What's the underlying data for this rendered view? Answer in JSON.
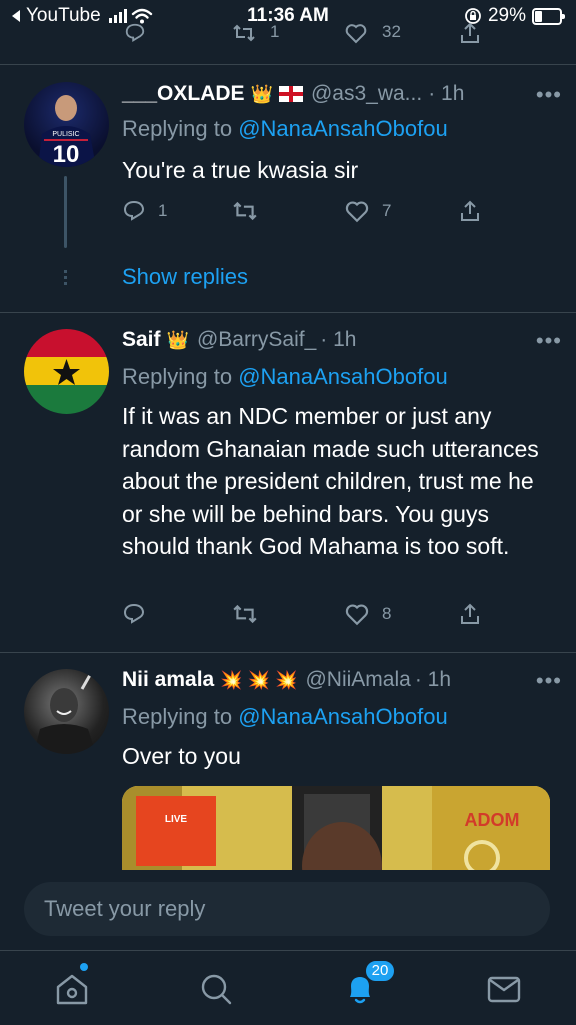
{
  "status_bar": {
    "back_app": "YouTube",
    "time": "11:36 AM",
    "battery": "29%"
  },
  "top_fragment": {
    "retweets": "1",
    "likes": "32"
  },
  "replies": [
    {
      "name": "___OXLADE",
      "name_emoji": "👑",
      "handle": "@as3_wa...",
      "time": "· 1h",
      "replying_prefix": "Replying to",
      "replying_to": "@NanaAnsahObofou",
      "text": "You're a true kwasia sir",
      "reply_count": "1",
      "retweet_count": "",
      "like_count": "7",
      "avatar": {
        "jersey_name": "PULISIC",
        "jersey_number": "10"
      }
    },
    {
      "name": "Saif",
      "name_emoji": "👑",
      "handle": "@BarrySaif_",
      "time": "· 1h",
      "replying_prefix": "Replying to",
      "replying_to": "@NanaAnsahObofou",
      "text": "If it was an NDC member or just any random Ghanaian made such utterances about the president children, trust me he or she will be behind bars. You guys should thank God Mahama is too soft.",
      "reply_count": "",
      "retweet_count": "",
      "like_count": "8"
    },
    {
      "name": "Nii amala",
      "name_emoji": "💥 💥 💥",
      "handle": "@NiiAmala",
      "time": "· 1h",
      "replying_prefix": "Replying to",
      "replying_to": "@NanaAnsahObofou",
      "text": "Over to you",
      "media": {
        "tv_tag": "LIVE",
        "station_logo": "ADOM"
      }
    }
  ],
  "thread": {
    "show_replies": "Show replies"
  },
  "more_glyph": "•••",
  "composer": {
    "placeholder": "Tweet your reply"
  },
  "tabbar": {
    "notifications_badge": "20"
  },
  "colors": {
    "background": "#15202b",
    "accent": "#1da1f2",
    "secondary_text": "#8899a6",
    "divider": "#38444d"
  }
}
